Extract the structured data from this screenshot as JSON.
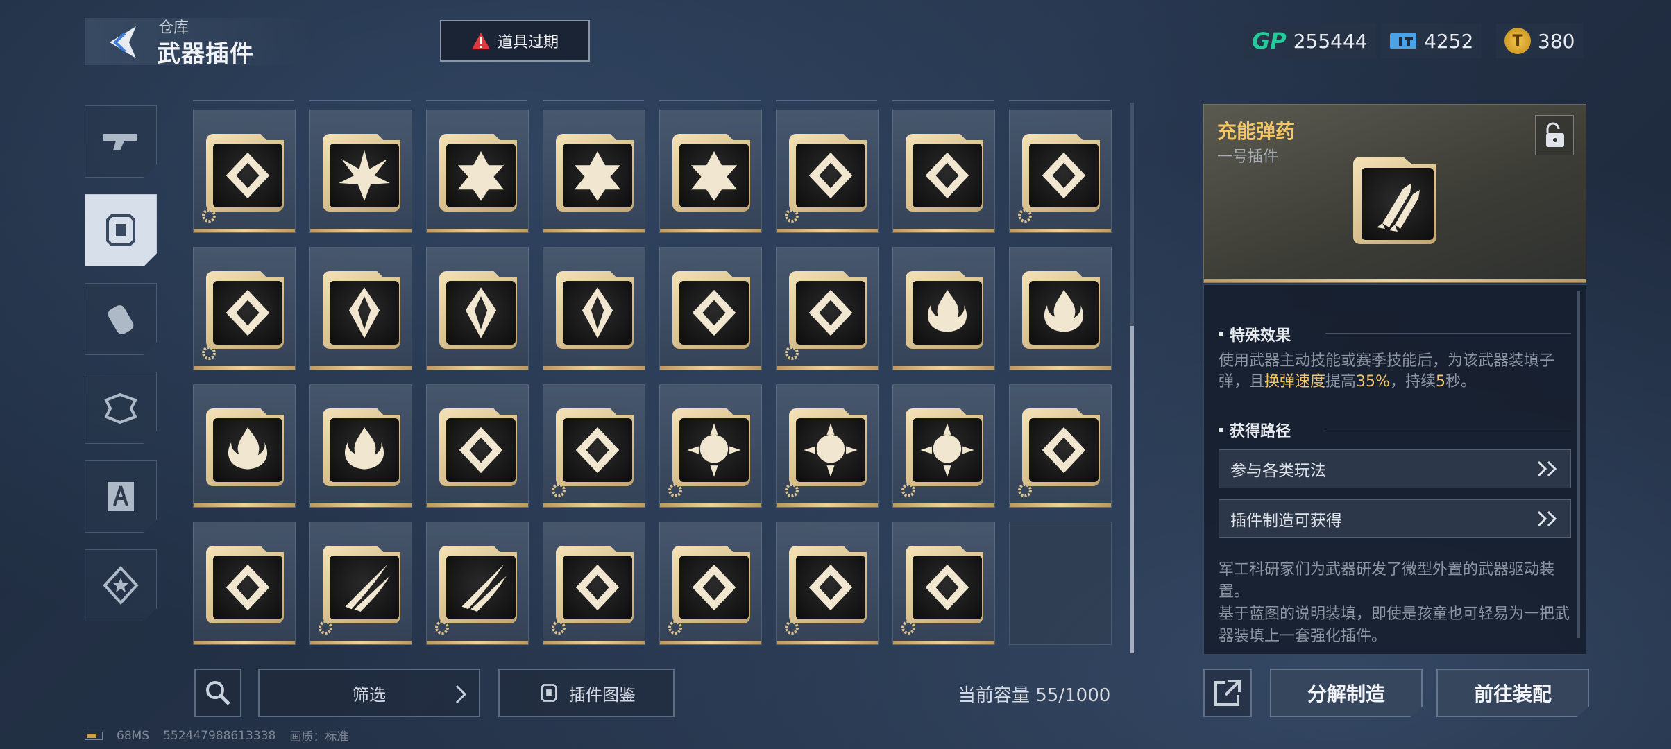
{
  "header": {
    "breadcrumb": "仓库",
    "title": "武器插件",
    "expire_button": "道具过期"
  },
  "currencies": [
    {
      "icon": "gp-icon",
      "value": "255444"
    },
    {
      "icon": "ticket-icon",
      "value": "4252"
    },
    {
      "icon": "gold-coin-icon",
      "value": "380"
    }
  ],
  "side_tabs": [
    {
      "icon": "pistol-icon",
      "active": false
    },
    {
      "icon": "plugin-frame-icon",
      "active": true
    },
    {
      "icon": "grenade-icon",
      "active": false
    },
    {
      "icon": "armor-icon",
      "active": false
    },
    {
      "icon": "skill-book-icon",
      "active": false
    },
    {
      "icon": "star-badge-icon",
      "active": false
    }
  ],
  "grid": {
    "rows": [
      [
        {
          "icon": "crosshair-swirl-icon",
          "gear": true
        },
        {
          "icon": "burst-icon",
          "gear": false
        },
        {
          "icon": "hexagram-icon",
          "gear": false
        },
        {
          "icon": "hexagram-icon",
          "gear": false
        },
        {
          "icon": "hexagram-icon",
          "gear": false
        },
        {
          "icon": "fist-up-icon",
          "gear": true
        },
        {
          "icon": "crossed-bullet-icon",
          "gear": false
        },
        {
          "icon": "target-pin-icon",
          "gear": true
        }
      ],
      [
        {
          "icon": "shatter-up-icon",
          "gear": true
        },
        {
          "icon": "crystal-icon",
          "gear": false
        },
        {
          "icon": "crystal-icon",
          "gear": false
        },
        {
          "icon": "crystal-icon",
          "gear": false
        },
        {
          "icon": "ornate-shield-icon",
          "gear": false
        },
        {
          "icon": "star-shield-icon",
          "gear": true
        },
        {
          "icon": "flame-icon",
          "gear": false
        },
        {
          "icon": "flame-icon",
          "gear": false
        }
      ],
      [
        {
          "icon": "flame-icon",
          "gear": false
        },
        {
          "icon": "flame-icon",
          "gear": false
        },
        {
          "icon": "magazine-up-icon",
          "gear": false
        },
        {
          "icon": "bull-skull-icon",
          "gear": true
        },
        {
          "icon": "spiked-orb-icon",
          "gear": true
        },
        {
          "icon": "spiked-orb-icon",
          "gear": true
        },
        {
          "icon": "spiked-orb-icon",
          "gear": true
        },
        {
          "icon": "medal-icon",
          "gear": true
        }
      ],
      [
        {
          "icon": "swirl-question-icon",
          "gear": false
        },
        {
          "icon": "claw-slash-icon",
          "gear": true
        },
        {
          "icon": "claw-slash-icon",
          "gear": true
        },
        {
          "icon": "demon-mask-icon",
          "gear": true
        },
        {
          "icon": "orbit-bullet-icon",
          "gear": true
        },
        {
          "icon": "slash-shield-icon",
          "gear": true
        },
        {
          "icon": "explosion-icon",
          "gear": true
        },
        {
          "icon": "",
          "gear": false,
          "empty": true
        }
      ]
    ]
  },
  "bottom_bar": {
    "filter_label": "筛选",
    "codex_label": "插件图鉴",
    "capacity": "当前容量 55/1000"
  },
  "detail": {
    "name": "充能弹药",
    "subtitle": "一号插件",
    "icon": "rocket-bullet-icon",
    "effect_title": "特殊效果",
    "effect_parts": [
      "使用武器主动技能或赛季技能后，为该武器装填子弹，且",
      "换弹速度",
      "提高",
      "35%",
      "，持续",
      "5",
      "秒。"
    ],
    "route_title": "获得路径",
    "routes": [
      "参与各类玩法",
      "插件制造可获得"
    ],
    "lore_line1": "军工科研家们为武器研发了微型外置的武器驱动装置。",
    "lore_line2": "基于蓝图的说明装填，即使是孩童也可轻易为一把武器装填上一套强化插件。"
  },
  "actions": {
    "disassemble": "分解制造",
    "equip": "前往装配"
  },
  "footer": {
    "ping": "68MS",
    "uid": "552447988613338",
    "quality": "画质：标准"
  },
  "colors": {
    "gold": "#f2c665",
    "card_gold": "#ecd39b",
    "gp_green": "#27c99a"
  }
}
